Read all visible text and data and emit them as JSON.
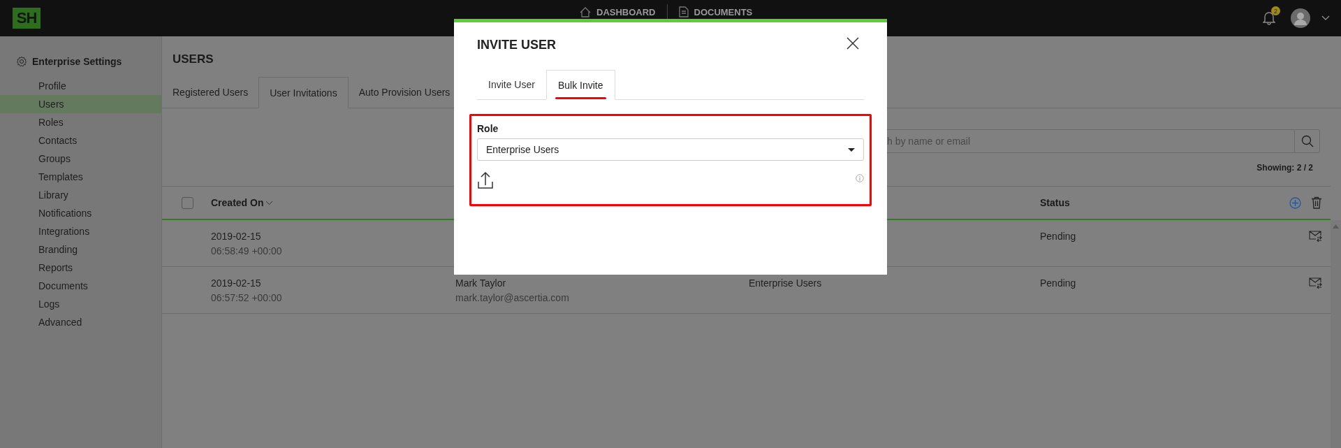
{
  "topbar": {
    "logo": "SH",
    "nav": [
      {
        "label": "DASHBOARD"
      },
      {
        "label": "DOCUMENTS"
      }
    ],
    "notification_count": "2"
  },
  "sidebar": {
    "title": "Enterprise Settings",
    "items": [
      {
        "label": "Profile",
        "selected": false
      },
      {
        "label": "Users",
        "selected": true
      },
      {
        "label": "Roles",
        "selected": false
      },
      {
        "label": "Contacts",
        "selected": false
      },
      {
        "label": "Groups",
        "selected": false
      },
      {
        "label": "Templates",
        "selected": false
      },
      {
        "label": "Library",
        "selected": false
      },
      {
        "label": "Notifications",
        "selected": false
      },
      {
        "label": "Integrations",
        "selected": false
      },
      {
        "label": "Branding",
        "selected": false
      },
      {
        "label": "Reports",
        "selected": false
      },
      {
        "label": "Documents",
        "selected": false
      },
      {
        "label": "Logs",
        "selected": false
      },
      {
        "label": "Advanced",
        "selected": false
      }
    ]
  },
  "page": {
    "title": "USERS",
    "tabs": [
      {
        "label": "Registered Users",
        "selected": false
      },
      {
        "label": "User Invitations",
        "selected": true
      },
      {
        "label": "Auto Provision Users",
        "selected": false
      }
    ],
    "search": {
      "placeholder": "h by name or email"
    },
    "showing": "Showing: 2 / 2",
    "table": {
      "select_all": {
        "checked": false
      },
      "created_column": {
        "label": "Created On",
        "sorted": true
      },
      "status_column": {
        "label": "Status"
      },
      "rows": [
        {
          "date": "2019-02-15",
          "time": "06:58:49 +00:00",
          "status": "Pending"
        },
        {
          "date": "2019-02-15",
          "time": "06:57:52 +00:00",
          "name": "Mark Taylor",
          "email": "mark.taylor@ascertia.com",
          "role": "Enterprise Users",
          "status": "Pending"
        }
      ]
    }
  },
  "modal": {
    "title": "INVITE USER",
    "tabs": [
      {
        "label": "Invite User",
        "selected": false
      },
      {
        "label": "Bulk Invite",
        "selected": true
      }
    ],
    "role": {
      "label": "Role",
      "value": "Enterprise Users"
    }
  }
}
